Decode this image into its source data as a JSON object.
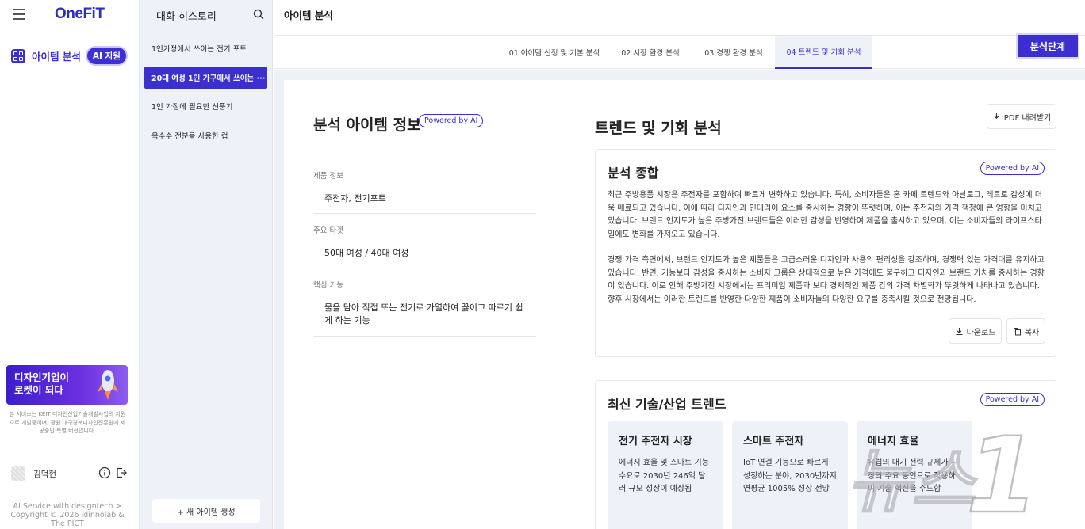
{
  "sidebar": {
    "logo": "OneFiT",
    "nav_item_label": "아이템 분석",
    "ai_badge": "AI 지원",
    "banner_line1": "디자인기업이",
    "banner_line2": "로켓이 되다",
    "disclaimer": "본 서비스는 KEIT 디자인산업기술개발사업의 지원으로 개발중이며, 광원 대구경북디자인진흥원에 제공중인 특별 버전입니다.",
    "user_name": "김덕현",
    "footer_line1": "AI Service with designtech >",
    "footer_line2": "Copyright © 2026 idinnolab &",
    "footer_line3": "The PICT"
  },
  "history": {
    "title": "대화 히스토리",
    "items": [
      {
        "label": "1인가정에서 쓰이는 전기 포트"
      },
      {
        "label": "20대 여성 1인 가구에서 쓰이는 ···"
      },
      {
        "label": "1인 가정에 필요한 선풍기"
      },
      {
        "label": "옥수수 전분을 사용한 컵"
      }
    ],
    "new_button": "+ 새 아이템 생성"
  },
  "header": {
    "title": "아이템 분석"
  },
  "tabs": [
    {
      "label": "01 아이템 선정 및 기본 분석"
    },
    {
      "label": "02 시장 환경 분석"
    },
    {
      "label": "03 경쟁 환경 분석"
    },
    {
      "label": "04 트렌드 및 기회 분석"
    }
  ],
  "stage_button": "분석단계",
  "item_info": {
    "title": "분석 아이템 정보",
    "ai_pill": "Powered by AI",
    "fields": [
      {
        "label": "제품 정보",
        "value": "주전자, 전기포트"
      },
      {
        "label": "주요 타겟",
        "value": "50대 여성 / 40대 여성"
      },
      {
        "label": "핵심 기능",
        "value": "물을 담아 직접 또는 전기로 가열하여 끓이고 따르기 쉽게 하는 기능"
      }
    ]
  },
  "trend": {
    "title": "트렌드 및 기회 분석",
    "pdf_button": "PDF 내려받기",
    "summary": {
      "title": "분석 종합",
      "ai_pill": "Powered by AI",
      "paragraph1": "최근 주방용품 시장은 주전자를 포함하여 빠르게 변화하고 있습니다. 특히, 소비자들은 홈 카페 트렌드와 아날로그, 레트로 감성에 더욱 매료되고 있습니다. 이에 따라 디자인과 인테리어 요소를 중시하는 경향이 뚜렷하며, 이는 주전자의 가격 책정에 큰 영향을 미치고 있습니다. 브랜드 인지도가 높은 주방가전 브랜드들은 이러한 감성을 반영하여 제품을 출시하고 있으며, 이는 소비자들의 라이프스타일에도 변화를 가져오고 있습니다.",
      "paragraph2": "경쟁 가격 측면에서, 브랜드 인지도가 높은 제품들은 고급스러운 디자인과 사용의 편리성을 강조하며, 경쟁력 있는 가격대를 유지하고 있습니다. 반면, 기능보다 감성을 중시하는 소비자 그룹은 상대적으로 높은 가격에도 불구하고 디자인과 브랜드 가치를 중시하는 경향이 있습니다. 이로 인해 주방가전 시장에서는 프리미엄 제품과 보다 경제적인 제품 간의 가격 차별화가 뚜렷하게 나타나고 있습니다. 향후 시장에서는 이러한 트렌드를 반영한 다양한 제품이 소비자들의 다양한 요구를 충족시킬 것으로 전망됩니다.",
      "download_button": "다운로드",
      "copy_button": "복사"
    },
    "tech": {
      "title": "최신 기술/산업 트렌드",
      "ai_pill": "Powered by AI",
      "cards": [
        {
          "title": "전기 주전자 시장",
          "desc": "에너지 효율 및 스마트 기능 수요로 2030년 246억 달러 규모 성장이 예상됨"
        },
        {
          "title": "스마트 주전자",
          "desc": "IoT 연결 기능으로 빠르게 성장하는 분야, 2030년까지 연평균 1005% 성장 전망"
        },
        {
          "title": "에너지 효율",
          "desc": "유럽의 대기 전력 규제가 시장의 주요 동인으로 작용하며 기술 혁신을 주도함"
        }
      ]
    }
  },
  "watermark": "뉴스1",
  "colors": {
    "accent": "#3b2fd0",
    "panel_bg": "#eef1f8"
  }
}
